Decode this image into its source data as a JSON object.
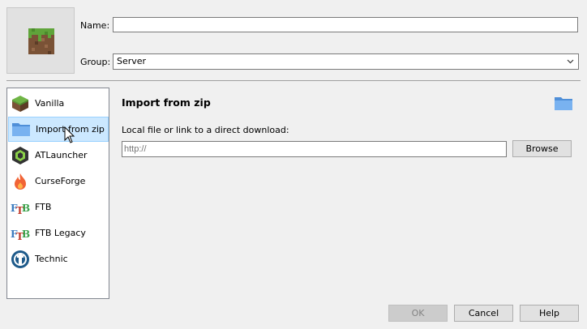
{
  "form": {
    "name_label": "Name:",
    "name_value": "",
    "group_label": "Group:",
    "group_value": "Server"
  },
  "sidebar": {
    "items": [
      {
        "label": "Vanilla",
        "icon": "grass-block-icon"
      },
      {
        "label": "Import from zip",
        "icon": "folder-icon",
        "selected": true
      },
      {
        "label": "ATLauncher",
        "icon": "atlauncher-icon"
      },
      {
        "label": "CurseForge",
        "icon": "curseforge-flame-icon"
      },
      {
        "label": "FTB",
        "icon": "ftb-icon"
      },
      {
        "label": "FTB Legacy",
        "icon": "ftb-icon"
      },
      {
        "label": "Technic",
        "icon": "technic-icon"
      }
    ]
  },
  "panel": {
    "title": "Import from zip",
    "source_label": "Local file or link to a direct download:",
    "url_value": "",
    "url_placeholder": "http://",
    "browse_label": "Browse"
  },
  "footer": {
    "ok_label": "OK",
    "ok_disabled": true,
    "cancel_label": "Cancel",
    "help_label": "Help"
  },
  "colors": {
    "selection_bg": "#cce8ff",
    "selection_border": "#99d1ff",
    "window_bg": "#f0f0f0"
  }
}
